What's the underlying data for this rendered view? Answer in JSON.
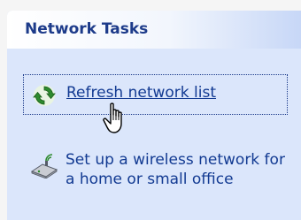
{
  "panel": {
    "title": "Network Tasks"
  },
  "tasks": [
    {
      "label": "Refresh network list",
      "icon": "refresh-icon",
      "hovered": true
    },
    {
      "label": "Set up a wireless network for a home or small office",
      "icon": "wireless-network-icon",
      "hovered": false
    }
  ],
  "cursor": {
    "icon": "hand-pointer-cursor"
  },
  "colors": {
    "link": "#123a92",
    "title": "#1d3b8a",
    "panel_bg": "#dbe6fb",
    "refresh_green": "#2d8a2d"
  }
}
